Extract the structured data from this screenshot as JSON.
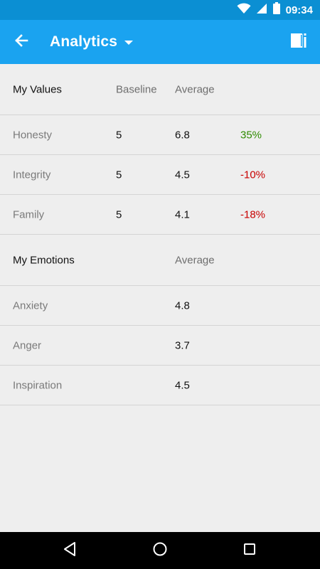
{
  "status_bar": {
    "time": "09:34",
    "icons": [
      "wifi-icon",
      "cell-signal-icon",
      "battery-icon"
    ]
  },
  "app_bar": {
    "title": "Analytics",
    "icons": [
      "back-arrow-icon",
      "dropdown-icon",
      "journal-icon"
    ]
  },
  "colors": {
    "status_bar": "#0b8fd3",
    "app_bar": "#1aa3f0",
    "positive": "#2e8b00",
    "negative": "#c80000",
    "background": "#eeeeee"
  },
  "values_section": {
    "title": "My Values",
    "col_baseline": "Baseline",
    "col_average": "Average",
    "rows": [
      {
        "label": "Honesty",
        "baseline": "5",
        "average": "6.8",
        "change": "35%"
      },
      {
        "label": "Integrity",
        "baseline": "5",
        "average": "4.5",
        "change": "-10%"
      },
      {
        "label": "Family",
        "baseline": "5",
        "average": "4.1",
        "change": "-18%"
      }
    ]
  },
  "emotions_section": {
    "title": "My Emotions",
    "col_average": "Average",
    "rows": [
      {
        "label": "Anxiety",
        "average": "4.8"
      },
      {
        "label": "Anger",
        "average": "3.7"
      },
      {
        "label": "Inspiration",
        "average": "4.5"
      }
    ]
  },
  "nav_bar": {
    "icons": [
      "nav-back-icon",
      "nav-home-icon",
      "nav-recents-icon"
    ]
  }
}
